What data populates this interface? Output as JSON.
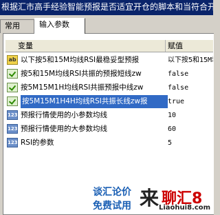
{
  "window": {
    "title": "根据汇市高手经验智能预报是否适宜开仓的脚本和当符合开"
  },
  "tabs": [
    "常用",
    "输入参数"
  ],
  "table": {
    "headers": [
      "变量",
      "赋值"
    ],
    "rows": [
      {
        "icon": "ab-icon",
        "label": "以下按5和15M均线RSI最稳妥型预报",
        "value": "以下按5和15M均线"
      },
      {
        "icon": "check-icon",
        "label": "按5和15M均线RSI共振的预报短线zw",
        "value": "false"
      },
      {
        "icon": "check-icon",
        "label": "按5M15M1H均线RSI共振预报中线zw",
        "value": "false"
      },
      {
        "icon": "check-icon",
        "label": "按5M15M1H4H均线RSI共振长线zw报",
        "value": "true",
        "selected": true
      },
      {
        "icon": "number-icon",
        "label": "预报行情使用的小参数均线",
        "value": "10"
      },
      {
        "icon": "number-icon",
        "label": "预报行情使用的大参数均线",
        "value": "60"
      },
      {
        "icon": "number-icon",
        "label": "RSI的参数",
        "value": "5"
      }
    ]
  },
  "ad": {
    "line1": "谈汇论价",
    "line2": "免费试用",
    "big": "来",
    "red": "聊汇8",
    "url": "Liaohui8.com"
  }
}
